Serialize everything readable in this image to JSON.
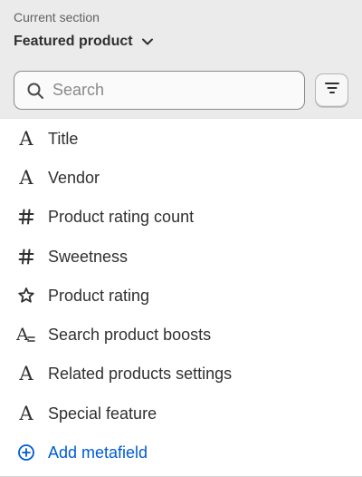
{
  "header": {
    "current_section_label": "Current section",
    "section_name": "Featured product"
  },
  "search": {
    "placeholder": "Search",
    "value": ""
  },
  "items": [
    {
      "label": "Title",
      "icon": "text-icon"
    },
    {
      "label": "Vendor",
      "icon": "text-icon"
    },
    {
      "label": "Product rating count",
      "icon": "hash-icon"
    },
    {
      "label": "Sweetness",
      "icon": "hash-icon"
    },
    {
      "label": "Product rating",
      "icon": "star-icon"
    },
    {
      "label": "Search product boosts",
      "icon": "text-list-icon"
    },
    {
      "label": "Related products settings",
      "icon": "text-icon"
    },
    {
      "label": "Special feature",
      "icon": "text-icon"
    }
  ],
  "add_metafield": {
    "label": "Add metafield",
    "icon": "plus-circle-icon"
  },
  "colors": {
    "header_bg": "#ebebeb",
    "text": "#303030",
    "link": "#005bd3"
  }
}
